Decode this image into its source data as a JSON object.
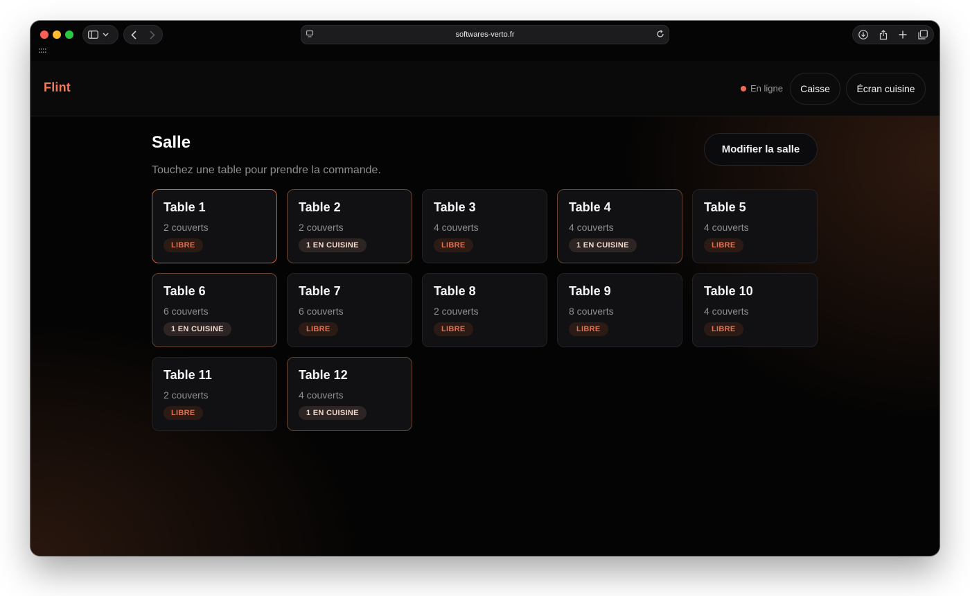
{
  "browser": {
    "url": "softwares-verto.fr"
  },
  "app": {
    "brand": "Flint",
    "status": "En ligne",
    "nav": {
      "caisse": "Caisse",
      "kitchen": "Écran cuisine"
    }
  },
  "main": {
    "title": "Salle",
    "subtitle": "Touchez une table pour prendre la commande.",
    "edit_button": "Modifier la salle"
  },
  "colors": {
    "accent": "#f27c5a",
    "free_badge_text": "#e2714f",
    "selected_border": "#c7653f"
  },
  "tables": [
    {
      "name": "Table 1",
      "covers": "2 couverts",
      "status": "LIBRE",
      "state": "selected"
    },
    {
      "name": "Table 2",
      "covers": "2 couverts",
      "status": "1 EN CUISINE",
      "state": "kitchen"
    },
    {
      "name": "Table 3",
      "covers": "4 couverts",
      "status": "LIBRE",
      "state": "free"
    },
    {
      "name": "Table 4",
      "covers": "4 couverts",
      "status": "1 EN CUISINE",
      "state": "kitchen"
    },
    {
      "name": "Table 5",
      "covers": "4 couverts",
      "status": "LIBRE",
      "state": "free"
    },
    {
      "name": "Table 6",
      "covers": "6 couverts",
      "status": "1 EN CUISINE",
      "state": "kitchen"
    },
    {
      "name": "Table 7",
      "covers": "6 couverts",
      "status": "LIBRE",
      "state": "free"
    },
    {
      "name": "Table 8",
      "covers": "2 couverts",
      "status": "LIBRE",
      "state": "free"
    },
    {
      "name": "Table 9",
      "covers": "8 couverts",
      "status": "LIBRE",
      "state": "free"
    },
    {
      "name": "Table 10",
      "covers": "4 couverts",
      "status": "LIBRE",
      "state": "free"
    },
    {
      "name": "Table 11",
      "covers": "2 couverts",
      "status": "LIBRE",
      "state": "free"
    },
    {
      "name": "Table 12",
      "covers": "4 couverts",
      "status": "1 EN CUISINE",
      "state": "kitchen"
    }
  ]
}
